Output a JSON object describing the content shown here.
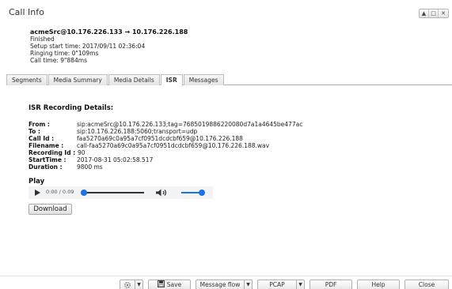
{
  "window": {
    "title": "Call Info",
    "controls": [
      "▲",
      "□",
      "✕"
    ]
  },
  "summary": {
    "heading": "acmeSrc@10.176.226.133 → 10.176.226.188",
    "status": "Finished",
    "setup_start": "Setup start time: 2017/09/11 02:36:04",
    "ringing": "Ringing time: 0\"109ms",
    "call_time": "Call time: 9\"884ms"
  },
  "tabs": [
    {
      "label": "Segments",
      "active": false
    },
    {
      "label": "Media Summary",
      "active": false
    },
    {
      "label": "Media Details",
      "active": false
    },
    {
      "label": "ISR",
      "active": true
    },
    {
      "label": "Messages",
      "active": false
    }
  ],
  "isr": {
    "title": "ISR Recording Details:",
    "rows": [
      {
        "label": "From :",
        "value": "sip:acmeSrc@10.176.226.133;tag=7685019886220080d7a1a4645be477ac"
      },
      {
        "label": "To :",
        "value": "sip:10.176.226.188:5060;transport=udp"
      },
      {
        "label": "Call Id :",
        "value": "faa5270a69c0a95a7cf0951dcdcbf659@10.176.226.188"
      },
      {
        "label": "Filename :",
        "value": "call-faa5270a69c0a95a7cf0951dcdcbf659@10.176.226.188.wav"
      },
      {
        "label": "Recording Id :",
        "value": "90"
      },
      {
        "label": "StartTime :",
        "value": "2017-08-31 05:02:58.517"
      },
      {
        "label": "Duration :",
        "value": "9800 ms"
      }
    ]
  },
  "player": {
    "label": "Play",
    "time": "0:00 / 0:09",
    "progress": 0.0,
    "volume": 1.0
  },
  "download_label": "Download",
  "bottombar": {
    "save": "Save",
    "message_flow": "Message flow",
    "pcap": "PCAP",
    "pdf": "PDF",
    "help": "Help",
    "close": "Close"
  },
  "colors": {
    "accent": "#1a73e8"
  }
}
